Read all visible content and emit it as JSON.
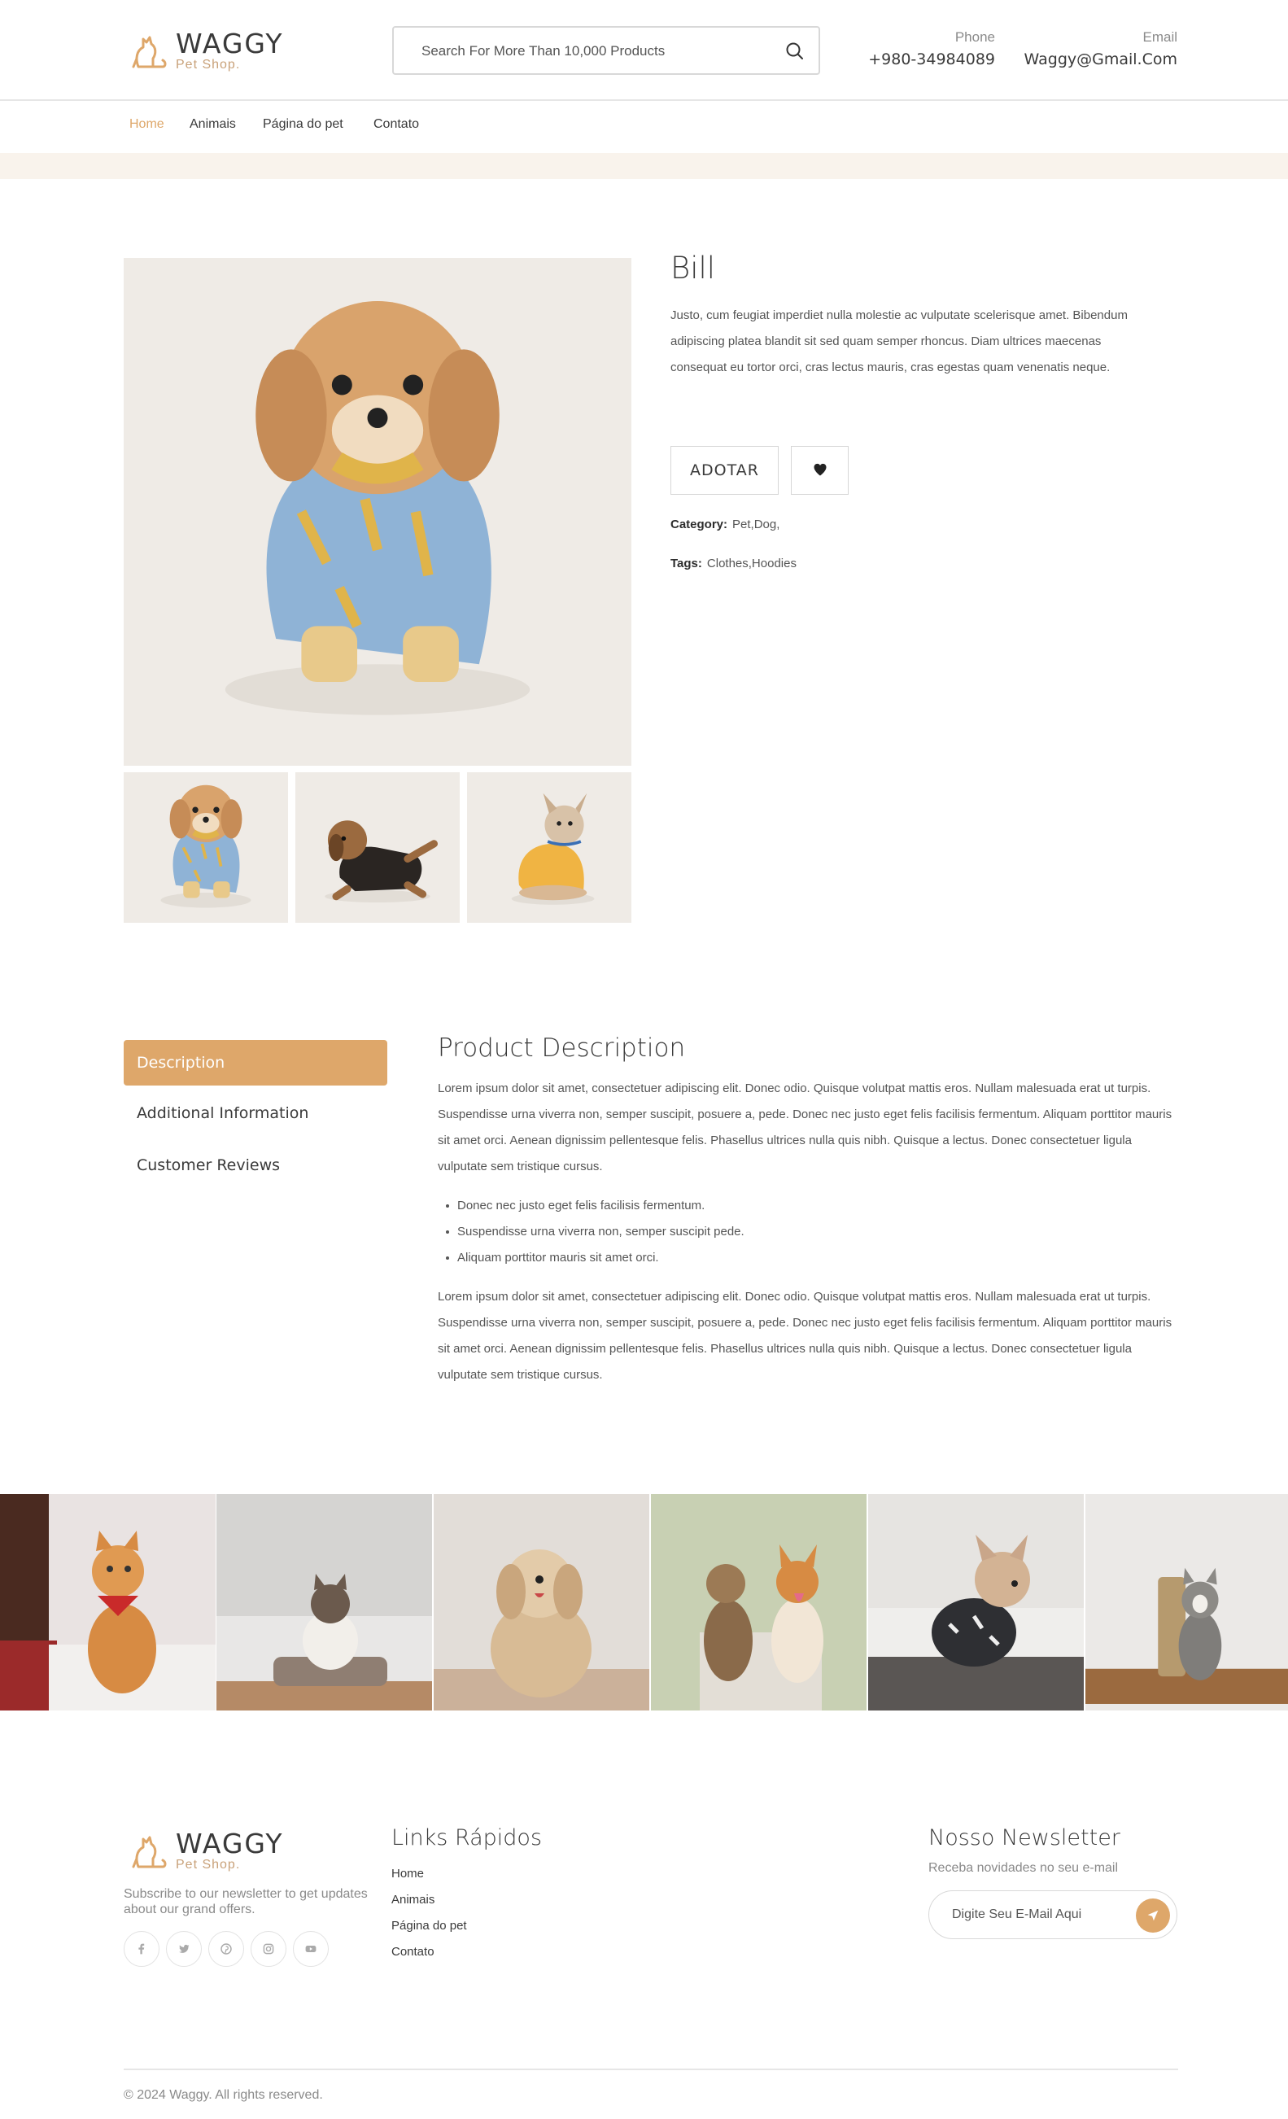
{
  "brand": {
    "name": "WAGGY",
    "tagline": "Pet Shop.",
    "accent_color": "#dea76a",
    "band_color": "#f9f3ec"
  },
  "header": {
    "search_placeholder": "Search For More Than 10,000 Products",
    "phone_label": "Phone",
    "phone_value": "+980-34984089",
    "email_label": "Email",
    "email_value": "Waggy@Gmail.Com"
  },
  "nav": {
    "items": [
      "Home",
      "Animais",
      "Página do pet",
      "Contato"
    ],
    "active": "Home"
  },
  "product": {
    "name": "Bill",
    "description": "Justo, cum feugiat imperdiet nulla molestie ac vulputate scelerisque amet. Bibendum adipiscing platea blandit sit sed quam semper rhoncus. Diam ultrices maecenas consequat eu tortor orci, cras lectus mauris, cras egestas quam venenatis neque.",
    "adopt_label": "ADOTAR",
    "category_label": "Category:",
    "category_value": "Pet,Dog,",
    "tags_label": "Tags:",
    "tags_value": "Clothes,Hoodies",
    "main_image": "shih-tzu-in-blue-hoodie",
    "thumbnails": [
      "shih-tzu-in-blue-hoodie",
      "puppy-in-black-hoodie",
      "french-bulldog-in-yellow-hoodie"
    ]
  },
  "tabs": {
    "items": [
      "Description",
      "Additional Information",
      "Customer Reviews"
    ],
    "active": "Description"
  },
  "description": {
    "title": "Product Description",
    "paragraph1": "Lorem ipsum dolor sit amet, consectetuer adipiscing elit. Donec odio. Quisque volutpat mattis eros. Nullam malesuada erat ut turpis. Suspendisse urna viverra non, semper suscipit, posuere a, pede. Donec nec justo eget felis facilisis fermentum. Aliquam porttitor mauris sit amet orci. Aenean dignissim pellentesque felis. Phasellus ultrices nulla quis nibh. Quisque a lectus. Donec consectetuer ligula vulputate sem tristique cursus.",
    "bullets": [
      "Donec nec justo eget felis facilisis fermentum.",
      "Suspendisse urna viverra non, semper suscipit pede.",
      "Aliquam porttitor mauris sit amet orci."
    ],
    "paragraph2": "Lorem ipsum dolor sit amet, consectetuer adipiscing elit. Donec odio. Quisque volutpat mattis eros. Nullam malesuada erat ut turpis. Suspendisse urna viverra non, semper suscipit, posuere a, pede. Donec nec justo eget felis facilisis fermentum. Aliquam porttitor mauris sit amet orci. Aenean dignissim pellentesque felis. Phasellus ultrices nulla quis nibh. Quisque a lectus. Donec consectetuer ligula vulputate sem tristique cursus."
  },
  "gallery": [
    "cat-with-red-bandana",
    "cat-on-pet-bed",
    "fluffy-puppy",
    "two-dogs-running",
    "french-bulldog-on-table",
    "kitten-scratching-post"
  ],
  "footer": {
    "subscribe_text": "Subscribe to our newsletter to get updates about our grand offers.",
    "social": [
      "facebook",
      "twitter",
      "pinterest",
      "instagram",
      "youtube"
    ],
    "links_title": "Links Rápidos",
    "links": [
      "Home",
      "Animais",
      "Página do pet",
      "Contato"
    ],
    "newsletter_title": "Nosso Newsletter",
    "newsletter_text": "Receba novidades no seu e-mail",
    "newsletter_placeholder": "Digite Seu E-Mail Aqui",
    "copyright": "© 2024 Waggy. All rights reserved."
  }
}
